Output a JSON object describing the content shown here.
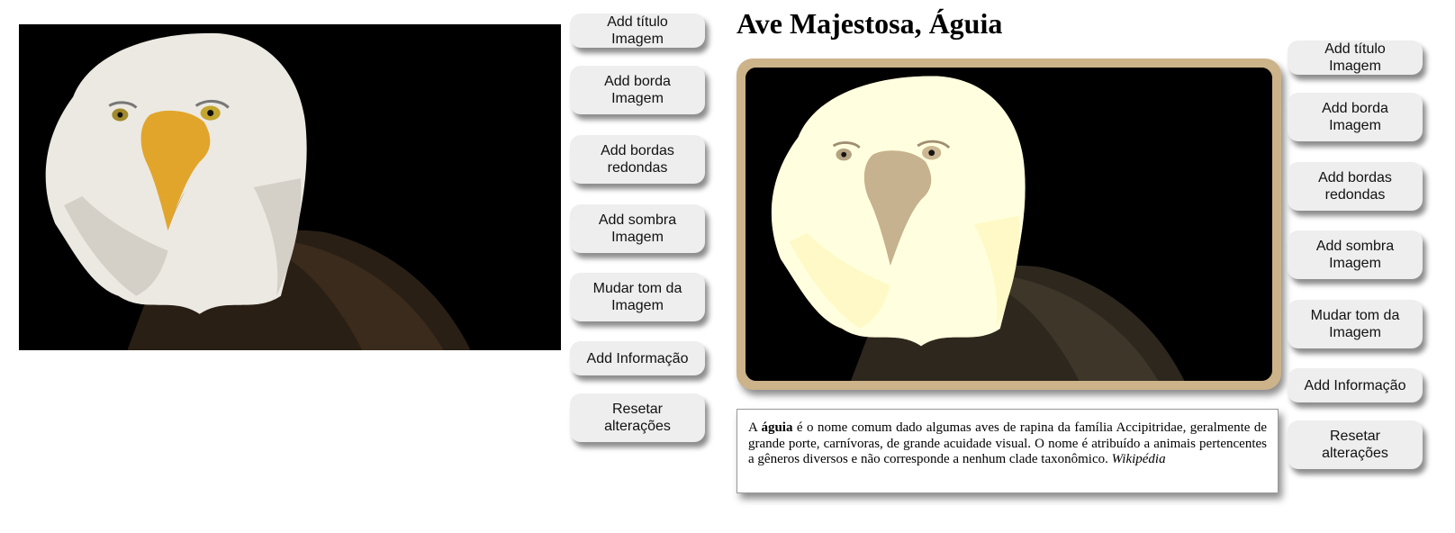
{
  "left_panel": {
    "image_alt": "Bald eagle portrait",
    "buttons": [
      "Add título Imagem",
      "Add borda Imagem",
      "Add bordas redondas",
      "Add sombra Imagem",
      "Mudar tom da Imagem",
      "Add Informação",
      "Resetar alterações"
    ]
  },
  "right_panel": {
    "title": "Ave Majestosa, Águia",
    "info": {
      "prefix": "A ",
      "bold_word": "águia",
      "text": " é o nome comum dado algumas aves de rapina da família Accipitridae, geralmente de grande porte, carnívoras, de grande acuidade visual. O nome é atribuído a animais pertencentes a gêneros diversos e não corresponde a nenhum clade taxonômico. ",
      "source": "Wikipédia"
    },
    "buttons": [
      "Add título Imagem",
      "Add borda Imagem",
      "Add bordas redondas",
      "Add sombra Imagem",
      "Mudar tom da Imagem",
      "Add Informação",
      "Resetar alterações"
    ]
  },
  "colors": {
    "frame": "#cdb38a",
    "button_bg": "#eeeeee",
    "beak": "#e2a52b"
  }
}
